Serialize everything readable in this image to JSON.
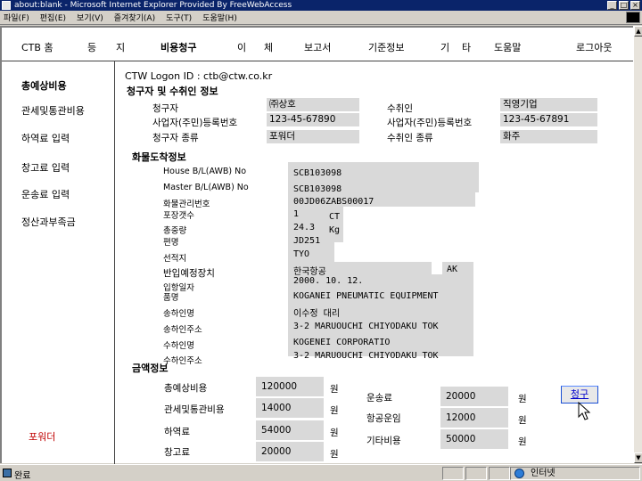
{
  "window": {
    "title": "about:blank - Microsoft Internet Explorer Provided By FreeWebAccess",
    "menu": [
      "파일(F)",
      "편집(E)",
      "보기(V)",
      "즐겨찾기(A)",
      "도구(T)",
      "도움말(H)"
    ]
  },
  "topnav": {
    "items": [
      "CTB 홈",
      "등",
      "지",
      "비용청구",
      "이",
      "체",
      "보고서",
      "기준정보",
      "기",
      "타",
      "도움말",
      "로그아웃"
    ]
  },
  "sidebar": {
    "items": [
      "총예상비용",
      "관세및통관비용",
      "하역료 입력",
      "창고료 입력",
      "운송료 입력",
      "정산과부족금"
    ],
    "bottom": "포워더"
  },
  "logon": "CTW Logon ID : ctb@ctw.co.kr",
  "sections": {
    "claimant": "청구자 및 수취인 정보",
    "cargo": "화물도착정보",
    "amount": "금액정보"
  },
  "claimant": {
    "claimant_label": "청구자",
    "claimant_value": "㈜상호",
    "biz_label": "사업자(주민)등록번호",
    "biz_value": "123-45-67890",
    "type_label": "청구자 종류",
    "type_value": "포워더",
    "recipient_label": "수취인",
    "recipient_value": "직영기업",
    "recipient_biz_label": "사업자(주민)등록번호",
    "recipient_biz_value": "123-45-67891",
    "recipient_type_label": "수취인 종류",
    "recipient_type_value": "화주"
  },
  "cargo": {
    "house_bl_label": "House B/L(AWB) No",
    "house_bl_value": "SCB103098",
    "master_bl_label": "Master B/L(AWB) No",
    "master_bl_value": "SCB103098",
    "mgmt_no_label": "화물관리번호",
    "mgmt_no_value": "00JD06ZABS00017",
    "packages_label": "포장갯수",
    "packages_value": "1",
    "packages_unit": "CT",
    "weight_label": "총중량",
    "weight_value": "24.3",
    "weight_unit": "Kg",
    "flight_label": "편명",
    "flight_value": "JD251",
    "origin_label": "선적지",
    "origin_value": "TYO",
    "warehouse_label": "반입예정장치",
    "warehouse_value": "한국항공",
    "warehouse_code": "AK",
    "arrival_label": "입항일자",
    "arrival_value": "2000. 10. 12.",
    "goods_label": "품명",
    "goods_value": "KOGANEI PNEUMATIC EQUIPMENT",
    "shipper_label": "송하인명",
    "shipper_value": "이수정 대리",
    "shipper_addr_label": "송하인주소",
    "shipper_addr_value": "3-2 MARUOUCHI CHIYODAKU TOK",
    "consignee_label": "수하인명",
    "consignee_value": "KOGENEI CORPORATIO",
    "consignee_addr_label": "수하인주소",
    "consignee_addr_value": "3-2 MARUOUCHI CHIYODAKU TOK"
  },
  "amount": {
    "currency_unit": "원",
    "left": [
      {
        "label": "총예상비용",
        "value": "120000"
      },
      {
        "label": "관세및통관비용",
        "value": "14000"
      },
      {
        "label": "하역료",
        "value": "54000"
      },
      {
        "label": "창고료",
        "value": "20000"
      }
    ],
    "right": [
      {
        "label": "운송료",
        "value": "20000"
      },
      {
        "label": "항공운임",
        "value": "12000"
      },
      {
        "label": "기타비용",
        "value": "50000"
      }
    ]
  },
  "submit_label": "청구",
  "status": {
    "text": "완료",
    "zone": "인터넷"
  }
}
